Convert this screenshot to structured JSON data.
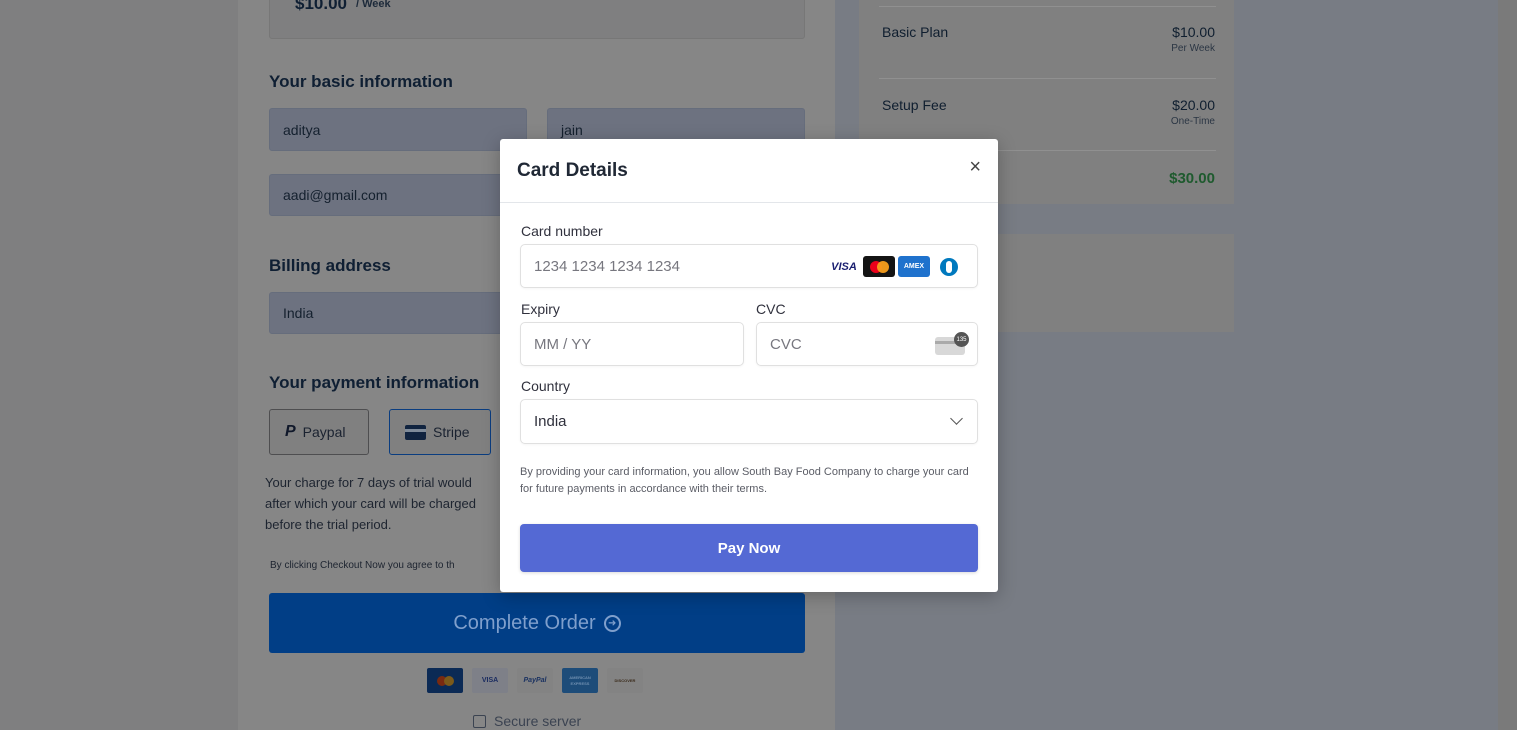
{
  "plan": {
    "price": "$10.00",
    "unit": "/ Week"
  },
  "basic_info": {
    "heading": "Your basic information",
    "first_name": "aditya",
    "last_name": "jain",
    "email": "aadi@gmail.com"
  },
  "billing": {
    "heading": "Billing address",
    "country": "India"
  },
  "payment": {
    "heading": "Your payment information",
    "paypal_label": "Paypal",
    "stripe_label": "Stripe",
    "trial_lines": [
      "Your charge for 7 days of trial would",
      "after which your card will be charged",
      "before the trial period."
    ],
    "agree_text": "By clicking Checkout Now you agree to th",
    "complete_label": "Complete Order",
    "secure_label": "Secure server",
    "footer_brands": [
      "VISA",
      "PayPal",
      "AMERICAN EXPRESS",
      "DISCOVER"
    ]
  },
  "summary": {
    "rows": [
      {
        "label": "Basic Plan",
        "amount": "$10.00",
        "sub": "Per Week"
      },
      {
        "label": "Setup Fee",
        "amount": "$20.00",
        "sub": "One-Time"
      }
    ],
    "total": "$30.00",
    "total_color": "#1e7a35"
  },
  "modal": {
    "title": "Card Details",
    "close": "×",
    "card_number_label": "Card number",
    "card_number_placeholder": "1234 1234 1234 1234",
    "card_brands": [
      "VISA",
      "mastercard",
      "AMEX",
      "diners"
    ],
    "expiry_label": "Expiry",
    "expiry_placeholder": "MM / YY",
    "cvc_label": "CVC",
    "cvc_placeholder": "CVC",
    "cvc_icon_text": "135",
    "country_label": "Country",
    "country_value": "India",
    "terms": "By providing your card information, you allow South Bay Food Company to charge your card for future payments in accordance with their terms.",
    "pay_label": "Pay Now",
    "accent": "#5469d4"
  }
}
